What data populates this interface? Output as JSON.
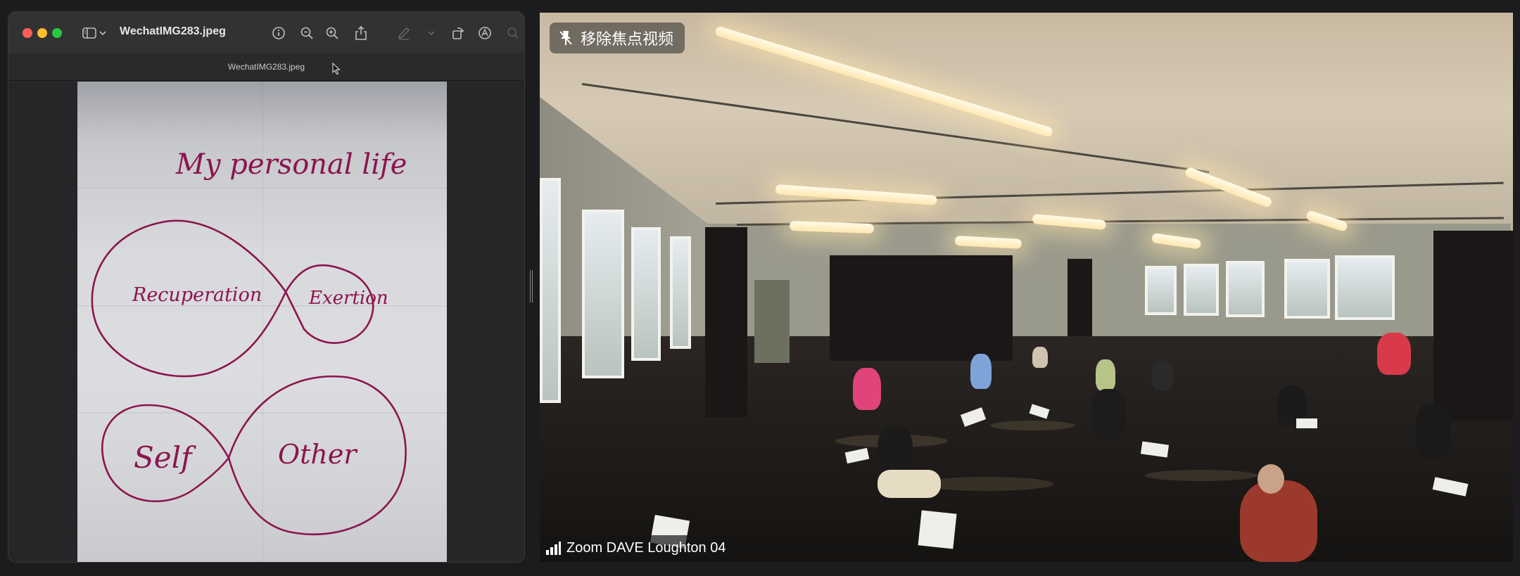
{
  "preview": {
    "window_title": "WechatIMG283.jpeg",
    "subtitle": "WechatIMG283.jpeg",
    "toolbar_icons": [
      "sidebar-icon",
      "chevron-down-icon",
      "info-icon",
      "zoom-out-icon",
      "zoom-in-icon",
      "share-icon",
      "markup-pen-icon",
      "chevron-down-icon",
      "rotate-icon",
      "annotate-icon",
      "search-icon"
    ],
    "document": {
      "heading": "My personal life",
      "loop_top_left": "Recuperation",
      "loop_top_right": "Exertion",
      "loop_bottom_left": "Self",
      "loop_bottom_right": "Other",
      "ink_color": "#8b1550"
    }
  },
  "video": {
    "pin_label": "移除焦点视频",
    "participant_name": "Zoom DAVE Loughton 04"
  },
  "colors": {
    "close": "#ff5f57",
    "minimize": "#febc2e",
    "maximize": "#28c840"
  }
}
